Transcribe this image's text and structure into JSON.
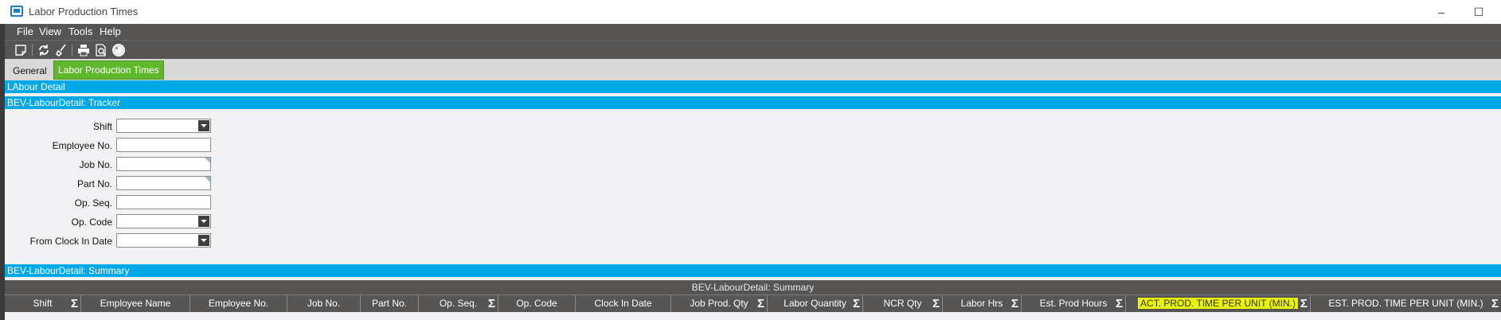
{
  "window": {
    "title": "Labor Production Times",
    "minimize": "–",
    "maximize": "☐"
  },
  "menu": {
    "file": "File",
    "view": "View",
    "tools": "Tools",
    "help": "Help"
  },
  "toolbar": {
    "icons": [
      "new-icon",
      "refresh-icon",
      "clear-icon",
      "print-icon",
      "print-preview-icon",
      "help-icon"
    ]
  },
  "tabs": {
    "general": "General",
    "labor_production_times": "Labor Production Times"
  },
  "bands": {
    "labour_detail": "LAbour Detail",
    "tracker": "BEV-LabourDetail: Tracker",
    "summary": "BEV-LabourDetail: Summary"
  },
  "form": {
    "shift": {
      "label": "Shift",
      "value": ""
    },
    "employee_no": {
      "label": "Employee No.",
      "value": ""
    },
    "job_no": {
      "label": "Job No.",
      "value": ""
    },
    "part_no": {
      "label": "Part No.",
      "value": ""
    },
    "op_seq": {
      "label": "Op. Seq.",
      "value": ""
    },
    "op_code": {
      "label": "Op. Code",
      "value": ""
    },
    "from_clock_in_date": {
      "label": "From Clock In Date",
      "value": ""
    }
  },
  "grid": {
    "title": "BEV-LabourDetail: Summary",
    "columns": [
      "Shift",
      "Employee Name",
      "Employee No.",
      "Job No.",
      "Part No.",
      "Op. Seq.",
      "Op. Code",
      "Clock In Date",
      "Job Prod. Qty",
      "Labor Quantity",
      "NCR Qty",
      "Labor Hrs",
      "Est. Prod Hours",
      "ACT. PROD. TIME PER UNIT (MIN.)",
      "EST. PROD. TIME PER UNIT (MIN.)"
    ],
    "sigma": "Σ"
  },
  "colors": {
    "accent_band": "#00a8e8",
    "active_tab": "#5fb82b",
    "chrome": "#565554",
    "highlight": "#e9f500"
  }
}
